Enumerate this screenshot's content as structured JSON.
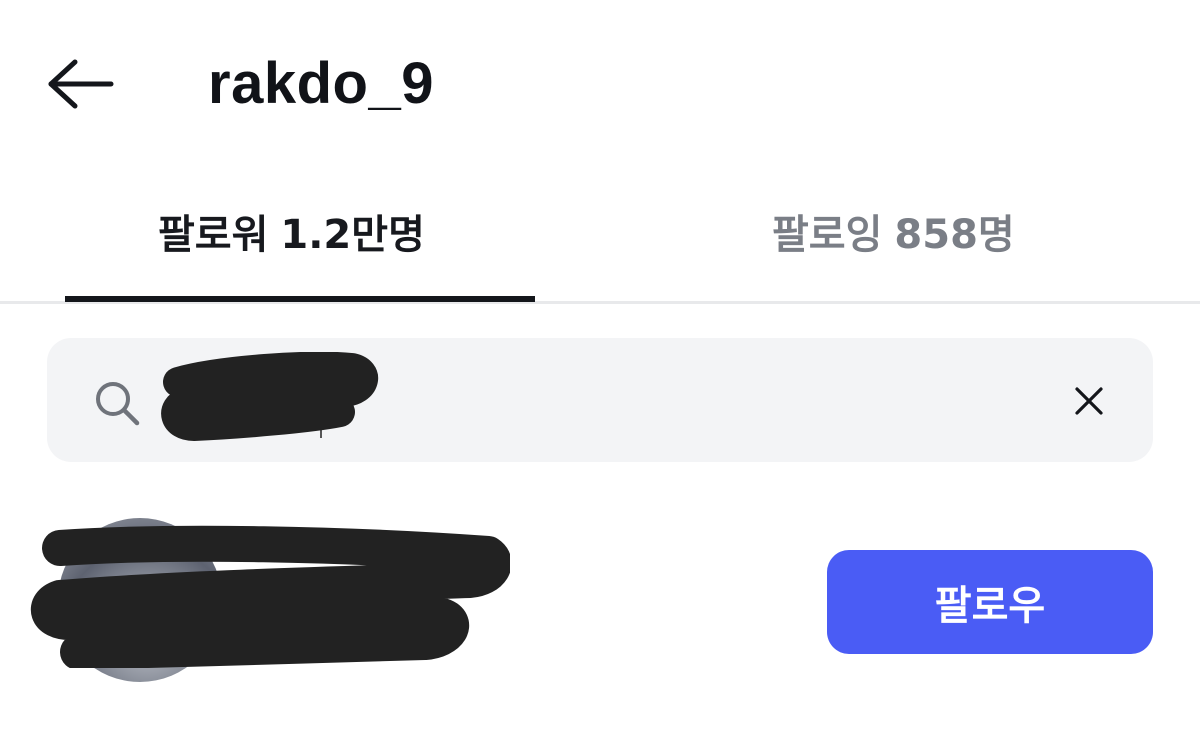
{
  "header": {
    "title": "rakdo_9",
    "back_icon": "arrow-left-icon"
  },
  "tabs": [
    {
      "label": "팔로워",
      "count": "1.2만명",
      "active": true
    },
    {
      "label": "팔로잉",
      "count": "858명",
      "active": false
    }
  ],
  "search": {
    "value": "",
    "search_icon": "search-icon",
    "clear_icon": "close-icon"
  },
  "results": [
    {
      "name": "",
      "button_label": "팔로우"
    }
  ],
  "colors": {
    "accent": "#4a5cf5",
    "text": "#111318",
    "muted": "#7a7e86",
    "search_bg": "#f3f4f6",
    "redaction": "#222222"
  }
}
